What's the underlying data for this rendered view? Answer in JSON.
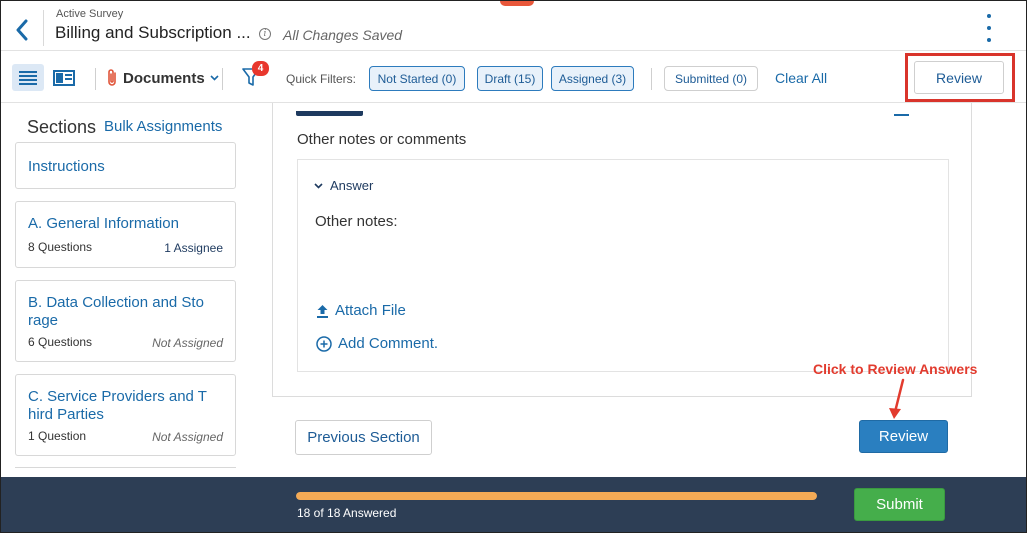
{
  "header": {
    "subtitle": "Active Survey",
    "title": "Billing and Subscription ...",
    "save_status": "All Changes Saved"
  },
  "toolbar": {
    "documents_label": "Documents",
    "filter_badge": "4",
    "quick_filters_label": "Quick Filters:",
    "chips": {
      "not_started": "Not Started (0)",
      "draft": "Draft (15)",
      "assigned": "Assigned (3)",
      "submitted": "Submitted (0)"
    },
    "clear_all": "Clear All",
    "review_label": "Review"
  },
  "sidebar": {
    "title": "Sections",
    "bulk_assignments": "Bulk Assignments",
    "sections": [
      {
        "name": "Instructions"
      },
      {
        "name_line1": "A. General Information",
        "questions": "8 Questions",
        "assignee": "1 Assignee"
      },
      {
        "name_line1": "B. Data Collection and Sto",
        "name_line2": "rage",
        "questions": "6 Questions",
        "assignee": "Not Assigned"
      },
      {
        "name_line1": "C. Service Providers and T",
        "name_line2": "hird Parties",
        "questions": "1 Question",
        "assignee": "Not Assigned"
      }
    ]
  },
  "main": {
    "question_text": "Other notes or comments",
    "answer_label": "Answer",
    "answer_text": "Other notes:",
    "attach_file": "Attach File",
    "add_comment": "Add Comment.",
    "previous_section": "Previous Section",
    "review_label": "Review",
    "annotation": "Click to Review Answers"
  },
  "footer": {
    "progress_text": "18 of 18 Answered",
    "progress_fraction": 1.0,
    "submit_label": "Submit"
  },
  "colors": {
    "accent": "#1a6aa8",
    "highlight": "#d9342b",
    "footer_bg": "#2d3e55",
    "progress": "#f4aa55",
    "submit": "#45ae4b"
  }
}
